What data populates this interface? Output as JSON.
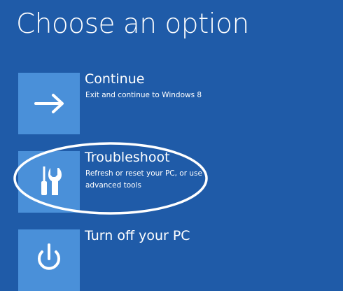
{
  "page": {
    "title": "Choose an option"
  },
  "options": [
    {
      "label": "Continue",
      "description": "Exit and continue to Windows 8",
      "icon": "arrow-right-icon"
    },
    {
      "label": "Troubleshoot",
      "description": "Refresh or reset your PC, or use advanced tools",
      "icon": "tools-icon"
    },
    {
      "label": "Turn off your PC",
      "description": "",
      "icon": "power-icon"
    }
  ],
  "colors": {
    "background": "#1f5ba8",
    "tile": "#4a90d9",
    "text": "#ffffff",
    "annotation": "#ffffff"
  }
}
